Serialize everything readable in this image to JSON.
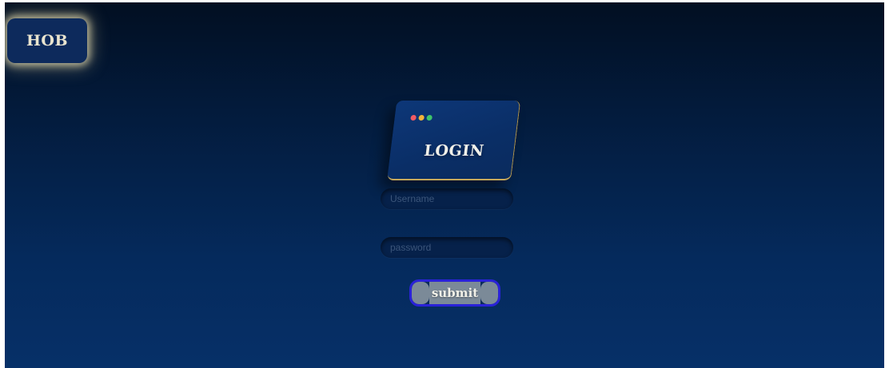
{
  "header": {
    "logo_text": "HOB"
  },
  "login_card": {
    "title": "LOGIN",
    "window_dots": [
      "#f05a63",
      "#f2b43a",
      "#3ec46a"
    ]
  },
  "form": {
    "username": {
      "placeholder": "Username",
      "value": ""
    },
    "password": {
      "placeholder": "password",
      "value": ""
    },
    "submit_label": "submit"
  },
  "colors": {
    "background_top": "#020f22",
    "background_bottom": "#063068",
    "card": "#0a2e66",
    "card_edge": "#c7a85a",
    "logo_glow": "#ebe1b4",
    "submit_border": "#2a22d8",
    "submit_fill": "#7b8a98"
  }
}
